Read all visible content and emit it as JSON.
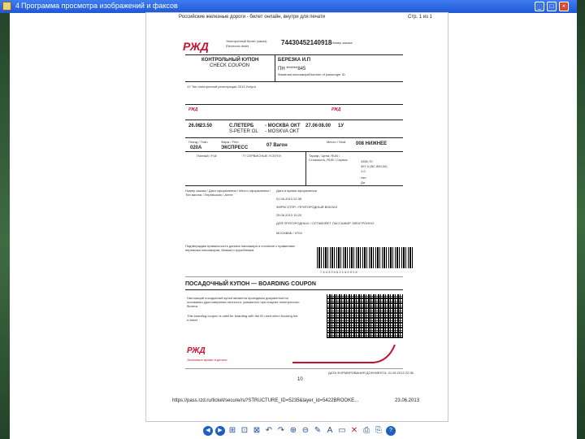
{
  "window": {
    "title_number": "4",
    "title": "Программа просмотра изображений и факсов",
    "controls": [
      "_",
      "□",
      "×"
    ]
  },
  "page": {
    "header_left": "Российские железные дороги - билет онлайн, внутри для печати",
    "header_right": "Стр. 1 из 1",
    "footer_url": "https://pass.rzd.ru/ticket/secure/ru?STRUCTURE_ID=5235&layer_id=5422BROOKE...",
    "footer_date": "23.06.2013",
    "page_number": "10"
  },
  "ticket": {
    "logo": "РЖД",
    "e_ticket_label": "Электронный билет (заказ)",
    "e_ticket_sub": "Electronic ticket",
    "ticket_number": "74430452140918",
    "order_label": "Номер заказа",
    "control_coupon": "КОНТРОЛЬНЫЙ КУПОН",
    "check_coupon": "CHECK COUPON",
    "passenger": "БЕРЕЗКА И.П",
    "passenger_doc": "ПН ******845",
    "doc_label": "Фамилия пассажира/Number of passenger ID",
    "route_from": "С.ПЕТЕРБ",
    "route_from_en": "S-PETER OL",
    "route_to": "- МОСКВА ОКТ",
    "route_to_en": "- MOSKVA OKT",
    "dep_date": "26.06",
    "dep_time": "23.50",
    "arr_date": "27.06",
    "arr_time": "08.00",
    "class": "1У",
    "train": "020А",
    "train_name": "ЭКСПРЕСС",
    "car": "07 Вагон",
    "seat": "008 НИЖНЕЕ",
    "fare_line": "77 СЕРВИСНЫЕ УСЛУГИ",
    "price_1": "2550,70",
    "price_2": "397,0 (ВС 850,00)",
    "price_3": "1.0",
    "yes_no_1": "Нет",
    "yes_no_2": "Да",
    "issued_date": "01.06.2013 22:35",
    "issued_place": "ФИРМ ОТПР / ПРИГОРОДНЫЙ ВОКЗАЛ",
    "validity": "25.06.2013 15:20",
    "carrier": "ДЛЯ ПРИГОРОДНЫХ / ОСТАВЛЯЕТ ПАССАЖИР ЭЛЕКТРОННО",
    "agent": "МОСКВАБ / 9704",
    "barcode_digits": "7 4 4 3 0 4 5 2 1 4 0 9 1 8",
    "boarding_title": "ПОСАДОЧНЫЙ КУПОН — BOARDING COUPON",
    "boarding_text_1": "Настоящий посадочный купон является проездным документом на основании удостоверения личности, указанного при покупке электронного билета.",
    "boarding_text_2": "This boarding coupon is valid for boarding with the ID used when booking the e-ticket.",
    "slogan": "Экономьте время и деньги",
    "issued_footer": "ДАТА ФОРМИРОВАНИЯ ДОКУМЕНТА: 01.06.2013 22:36"
  },
  "toolbar": {
    "icons": [
      "◀",
      "▶",
      "⊞",
      "⊡",
      "⊠",
      "↶",
      "↷",
      "⊕",
      "⊖",
      "✎",
      "A",
      "▭",
      "✕",
      "⎙",
      "⎘",
      "?"
    ]
  }
}
